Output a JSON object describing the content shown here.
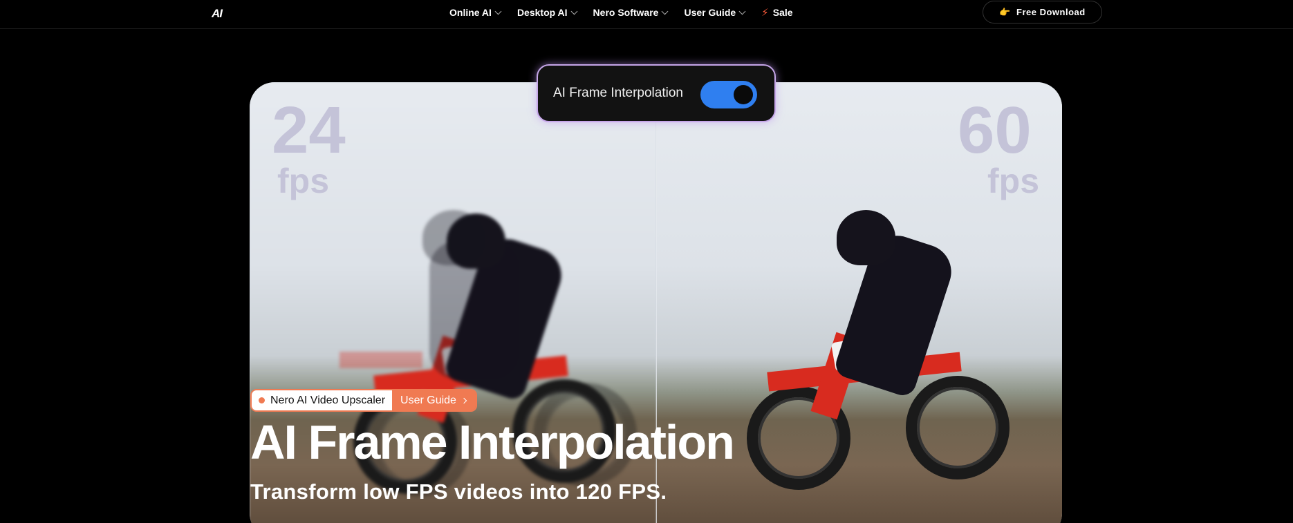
{
  "nav": {
    "logo": "AI",
    "items": [
      {
        "label": "Online AI"
      },
      {
        "label": "Desktop AI"
      },
      {
        "label": "Nero Software"
      },
      {
        "label": "User Guide"
      }
    ],
    "sale_label": "Sale",
    "download_label": "Free Download",
    "download_icon": "pointing-hand-icon",
    "sale_icon": "lightning-bolt-icon"
  },
  "hero": {
    "left_fps_number": "24",
    "left_fps_unit": "fps",
    "right_fps_number": "60",
    "right_fps_unit": "fps",
    "toggle_label": "AI Frame Interpolation",
    "toggle_on": true,
    "badge_product": "Nero AI Video Upscaler",
    "badge_link": "User Guide",
    "title": "AI Frame Interpolation",
    "subtitle": "Transform low FPS videos into 120 FPS."
  },
  "colors": {
    "accent_orange": "#f07a52",
    "toggle_blue": "#2f7ff0",
    "glow_purple": "#c7a7ea",
    "fps_text": "#c4c3d8"
  }
}
